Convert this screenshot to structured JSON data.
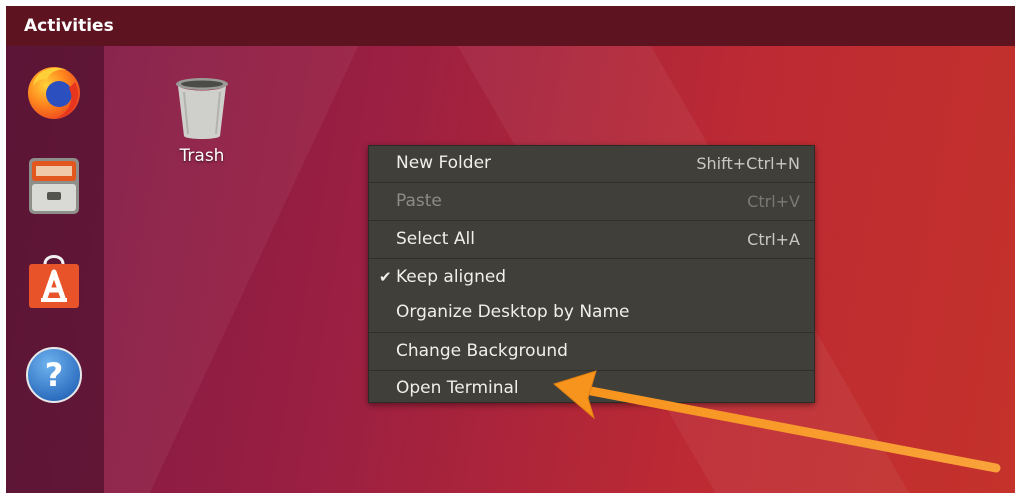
{
  "topbar": {
    "activities": "Activities"
  },
  "dock": {
    "items": [
      {
        "icon": "firefox-icon"
      },
      {
        "icon": "files-icon"
      },
      {
        "icon": "software-center-icon"
      },
      {
        "icon": "help-icon"
      }
    ]
  },
  "desktop": {
    "trash_label": "Trash"
  },
  "context_menu": {
    "new_folder": {
      "label": "New Folder",
      "shortcut": "Shift+Ctrl+N"
    },
    "paste": {
      "label": "Paste",
      "shortcut": "Ctrl+V"
    },
    "select_all": {
      "label": "Select All",
      "shortcut": "Ctrl+A"
    },
    "keep_aligned": {
      "label": "Keep aligned",
      "check": "✔"
    },
    "organize": {
      "label": "Organize Desktop by Name"
    },
    "change_background": {
      "label": "Change Background"
    },
    "open_terminal": {
      "label": "Open Terminal"
    }
  },
  "colors": {
    "topbar": "#5e1420",
    "menu_bg": "#403f3a",
    "annotation_arrow": "#f7941d"
  }
}
